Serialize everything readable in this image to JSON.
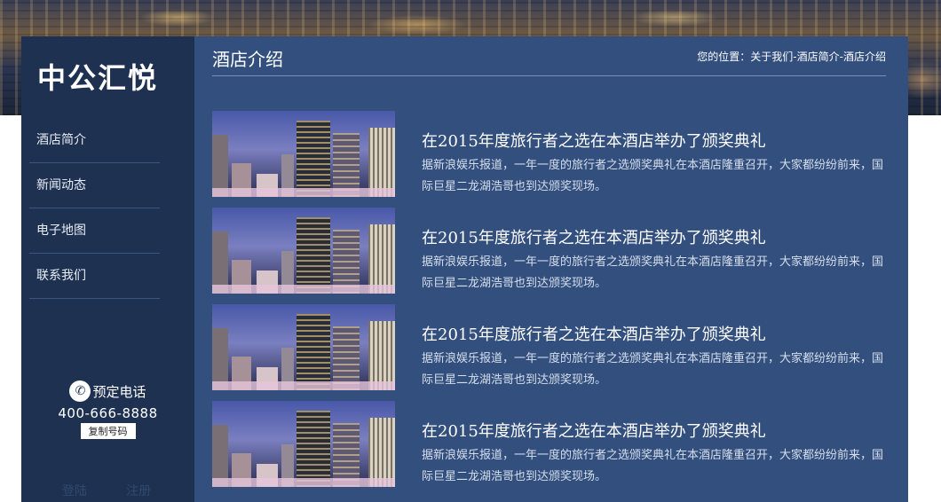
{
  "brand": {
    "logo": "中公汇悦"
  },
  "nav": [
    "酒店简介",
    "新闻动态",
    "电子地图",
    "联系我们"
  ],
  "contact": {
    "title": "预定电话",
    "phone": "400-666-8888",
    "copy_label": "复制号码"
  },
  "auth": {
    "login": "登陆",
    "register": "注册"
  },
  "page": {
    "title": "酒店介绍"
  },
  "breadcrumb": {
    "prefix": "您的位置：",
    "items": [
      "关于我们",
      "酒店简介",
      "酒店介绍"
    ],
    "sep": "-"
  },
  "articles": [
    {
      "title": "在2015年度旅行者之选在本酒店举办了颁奖典礼",
      "desc": "据新浪娱乐报道，一年一度的旅行者之选颁奖典礼在本酒店隆重召开，大家都纷纷前来，国际巨星二龙湖浩哥也到达颁奖现场。"
    },
    {
      "title": "在2015年度旅行者之选在本酒店举办了颁奖典礼",
      "desc": "据新浪娱乐报道，一年一度的旅行者之选颁奖典礼在本酒店隆重召开，大家都纷纷前来，国际巨星二龙湖浩哥也到达颁奖现场。"
    },
    {
      "title": "在2015年度旅行者之选在本酒店举办了颁奖典礼",
      "desc": "据新浪娱乐报道，一年一度的旅行者之选颁奖典礼在本酒店隆重召开，大家都纷纷前来，国际巨星二龙湖浩哥也到达颁奖现场。"
    },
    {
      "title": "在2015年度旅行者之选在本酒店举办了颁奖典礼",
      "desc": "据新浪娱乐报道，一年一度的旅行者之选颁奖典礼在本酒店隆重召开，大家都纷纷前来，国际巨星二龙湖浩哥也到达颁奖现场。"
    }
  ],
  "icons": {
    "phone": "phone-icon"
  },
  "colors": {
    "sidebar": "#1e3150",
    "content": "#324f7e"
  }
}
